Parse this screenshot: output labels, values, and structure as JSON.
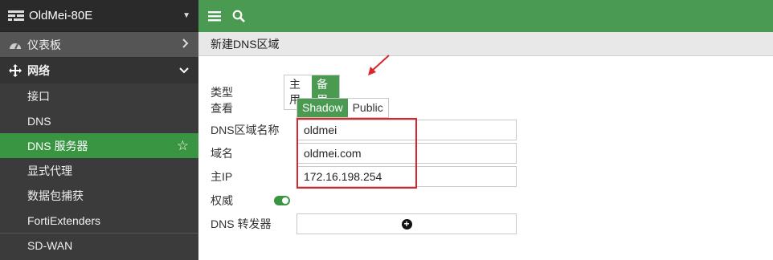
{
  "device": {
    "name": "OldMei-80E"
  },
  "sidebar": {
    "dashboard": "仪表板",
    "network": "网络",
    "items": [
      {
        "label": "接口"
      },
      {
        "label": "DNS"
      },
      {
        "label": "DNS 服务器"
      },
      {
        "label": "显式代理"
      },
      {
        "label": "数据包捕获"
      },
      {
        "label": "FortiExtenders"
      }
    ],
    "sdwan": "SD-WAN"
  },
  "page": {
    "title": "新建DNS区域"
  },
  "form": {
    "type_label": "类型",
    "type_options": [
      "主用",
      "备用"
    ],
    "type_selected": "备用",
    "view_label": "查看",
    "view_options": [
      "Shadow",
      "Public"
    ],
    "view_selected": "Shadow",
    "zone_label": "DNS区域名称",
    "zone_value": "oldmei",
    "domain_label": "域名",
    "domain_value": "oldmei.com",
    "ip_label": "主IP",
    "ip_value": "172.16.198.254",
    "auth_label": "权威",
    "auth_on": true,
    "forwarder_label": "DNS 转发器"
  },
  "colors": {
    "accent": "#4a9a52",
    "annotation": "#d9262b"
  }
}
